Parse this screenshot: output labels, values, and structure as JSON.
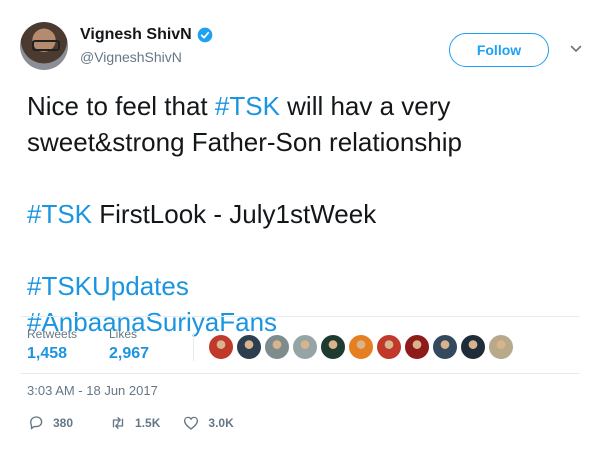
{
  "user": {
    "display_name": "Vignesh ShivN",
    "handle": "@VigneshShivN",
    "verified_icon": "verified-badge-icon",
    "avatar_icon": "user-avatar"
  },
  "follow_button": {
    "label": "Follow"
  },
  "menu_caret_icon": "chevron-down-icon",
  "tweet": {
    "lines": [
      [
        {
          "t": "Nice to feel that "
        },
        {
          "t": "#TSK",
          "tag": true
        },
        {
          "t": " will hav a very"
        }
      ],
      [
        {
          "t": "sweet&strong Father-Son relationship"
        }
      ],
      [],
      [
        {
          "t": "#TSK",
          "tag": true
        },
        {
          "t": " FirstLook - July1stWeek"
        }
      ],
      [],
      [
        {
          "t": "#TSKUpdates",
          "tag": true
        }
      ],
      [
        {
          "t": "#AnbaanaSuriyaFans",
          "tag": true
        }
      ]
    ]
  },
  "stats": {
    "retweets_label": "Retweets",
    "retweets_value": "1,458",
    "likes_label": "Likes",
    "likes_value": "2,967"
  },
  "likers": [
    "#c0392b",
    "#2c3e50",
    "#7f8c8d",
    "#95a5a6",
    "#1f3a2e",
    "#e67e22",
    "#c0392b",
    "#8e1a1a",
    "#34495e",
    "#1f2d3a",
    "#b8a98a"
  ],
  "timestamp": "3:03 AM - 18 Jun 2017",
  "actions": {
    "reply_count": "380",
    "retweet_count": "1.5K",
    "like_count": "3.0K"
  },
  "colors": {
    "accent": "#1da1f2",
    "hashtag": "#1b95e0",
    "muted": "#657786",
    "divider": "#e6ecf0"
  }
}
